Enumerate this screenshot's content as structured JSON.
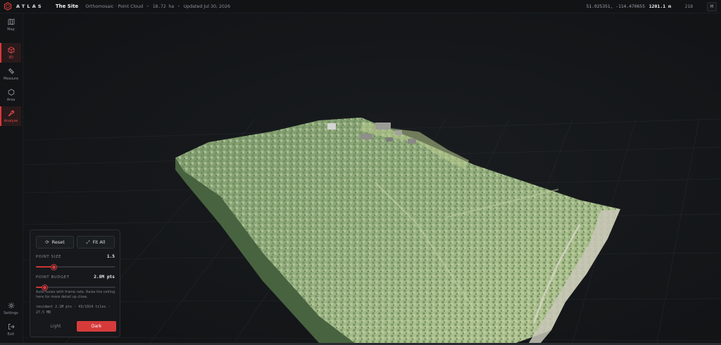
{
  "app": {
    "brand": "ATLAS",
    "site_title": "The Site"
  },
  "header": {
    "dataset": "Orthomosaic · Point Cloud",
    "area": "18.72 ha",
    "updated": "Updated Jul 30, 2026",
    "coords": "51.025351, -114.470655",
    "altitude": "1201.1 m",
    "fps": "218",
    "avatar": "M"
  },
  "sidebar": {
    "items": [
      {
        "label": "Map",
        "icon": "map-icon",
        "active": false
      },
      {
        "label": "3D",
        "icon": "cube-icon",
        "active": true
      },
      {
        "label": "Measure",
        "icon": "ruler-icon",
        "active": false
      },
      {
        "label": "Area",
        "icon": "hexagon-icon",
        "active": false
      },
      {
        "label": "Analyze",
        "icon": "wrench-icon",
        "active": true
      }
    ],
    "bottom": [
      {
        "label": "Settings",
        "icon": "gear-icon"
      },
      {
        "label": "Exit",
        "icon": "exit-icon"
      }
    ]
  },
  "panel": {
    "reset_label": "Reset",
    "fitall_label": "Fit All",
    "point_size_label": "POINT SIZE",
    "point_size_value": "1.5",
    "point_size_fraction": 0.23,
    "point_budget_label": "POINT BUDGET",
    "point_budget_value": "2.8M pts",
    "point_budget_fraction": 0.11,
    "hint": "Auto-tunes with frame rate. Raise the ceiling here for more detail up close.",
    "stats": "resident 2.1M pts · 43/1914 tiles · 27.5 MB",
    "light_label": "Light",
    "dark_label": "Dark"
  },
  "colors": {
    "accent": "#d63b3b",
    "background": "#131517"
  }
}
